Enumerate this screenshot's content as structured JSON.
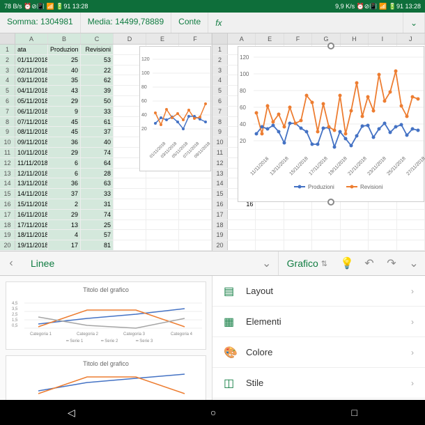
{
  "status": {
    "left": "78 B/s ⏰⊘📳 📶 🔋91 13:28",
    "right": "9,9 K/s ⏰⊘📳 📶 🔋91 13:28"
  },
  "stats": {
    "sum": "Somma: 1304981",
    "avg": "Media: 14499,78889",
    "count": "Conte"
  },
  "fx": "fx",
  "left_cols": [
    "A",
    "B",
    "C",
    "D",
    "E",
    "F"
  ],
  "right_cols": [
    "A",
    "E",
    "F",
    "G",
    "H",
    "I",
    "J"
  ],
  "headers": {
    "a": "ata",
    "b": "Produzion",
    "c": "Revisioni"
  },
  "data_rows": [
    [
      "01/11/2018",
      "25",
      "53"
    ],
    [
      "02/11/2018",
      "40",
      "22"
    ],
    [
      "03/11/2018",
      "35",
      "62"
    ],
    [
      "04/11/2018",
      "43",
      "39"
    ],
    [
      "05/11/2018",
      "29",
      "50"
    ],
    [
      "06/11/2018",
      "9",
      "33"
    ],
    [
      "07/11/2018",
      "45",
      "61"
    ],
    [
      "08/11/2018",
      "45",
      "37"
    ],
    [
      "09/11/2018",
      "36",
      "40"
    ],
    [
      "10/11/2018",
      "29",
      "74"
    ],
    [
      "11/11/2018",
      "6",
      "64"
    ],
    [
      "12/11/2018",
      "6",
      "28"
    ],
    [
      "13/11/2018",
      "36",
      "63"
    ],
    [
      "14/11/2018",
      "37",
      "33"
    ],
    [
      "15/11/2018",
      "2",
      "31"
    ],
    [
      "16/11/2018",
      "29",
      "74"
    ],
    [
      "17/11/2018",
      "13",
      "25"
    ],
    [
      "18/11/2018",
      "4",
      "57"
    ],
    [
      "19/11/2018",
      "17",
      "81"
    ]
  ],
  "toolbar": {
    "linee": "Linee",
    "grafico": "Grafico"
  },
  "opts": [
    {
      "icon": "▤",
      "label": "Layout"
    },
    {
      "icon": "▦",
      "label": "Elementi"
    },
    {
      "icon": "🎨",
      "label": "Colore"
    },
    {
      "icon": "◫",
      "label": "Stile"
    }
  ],
  "preview_title": "Titolo del grafico",
  "preview_cats": [
    "Categoria 1",
    "Categoria 2",
    "Categoria 3",
    "Categoria 4"
  ],
  "preview_legend": [
    "Serie 1",
    "Serie 2",
    "Serie 3"
  ],
  "chart_data": [
    {
      "type": "line",
      "title": "",
      "xlabel": "",
      "ylabel": "",
      "categories": [
        "01/11/2018",
        "03/11/2018",
        "05/11/2018",
        "07/11/2018",
        "09/11/2018"
      ],
      "y_ticks": [
        20,
        40,
        60,
        80,
        100,
        120
      ],
      "row_ticks": [
        1,
        2,
        3,
        4,
        5,
        6,
        7,
        8,
        9,
        10
      ],
      "series": [
        {
          "name": "Produzioni",
          "color": "#4472c4",
          "values": [
            25,
            40,
            35,
            43,
            29,
            9,
            45,
            45,
            36,
            29
          ]
        },
        {
          "name": "Revisioni",
          "color": "#ed7d31",
          "values": [
            53,
            22,
            62,
            39,
            50,
            33,
            61,
            37,
            40,
            74
          ]
        }
      ]
    },
    {
      "type": "line",
      "title": "",
      "xlabel": "",
      "ylabel": "",
      "categories": [
        "11/11/2018",
        "13/11/2018",
        "15/11/2018",
        "17/11/2018",
        "19/11/2018",
        "21/11/2018",
        "23/11/2018",
        "25/11/2018",
        "27/11/2018"
      ],
      "y_ticks": [
        20,
        40,
        60,
        80,
        100,
        120
      ],
      "legend": [
        "Produzioni",
        "Revisioni"
      ],
      "series": [
        {
          "name": "Produzioni",
          "color": "#4472c4",
          "values": [
            25,
            40,
            35,
            43,
            29,
            9,
            45,
            45,
            36,
            29,
            6,
            6,
            36,
            37,
            2,
            29,
            13,
            4,
            17,
            38,
            42,
            18,
            33,
            45,
            28,
            39,
            44,
            21,
            35
          ]
        },
        {
          "name": "Revisioni",
          "color": "#ed7d31",
          "values": [
            53,
            22,
            62,
            39,
            50,
            33,
            61,
            37,
            40,
            74,
            64,
            28,
            63,
            33,
            31,
            74,
            25,
            57,
            81,
            48,
            72,
            55,
            91,
            68,
            78,
            96,
            62,
            48,
            72
          ]
        }
      ]
    }
  ]
}
